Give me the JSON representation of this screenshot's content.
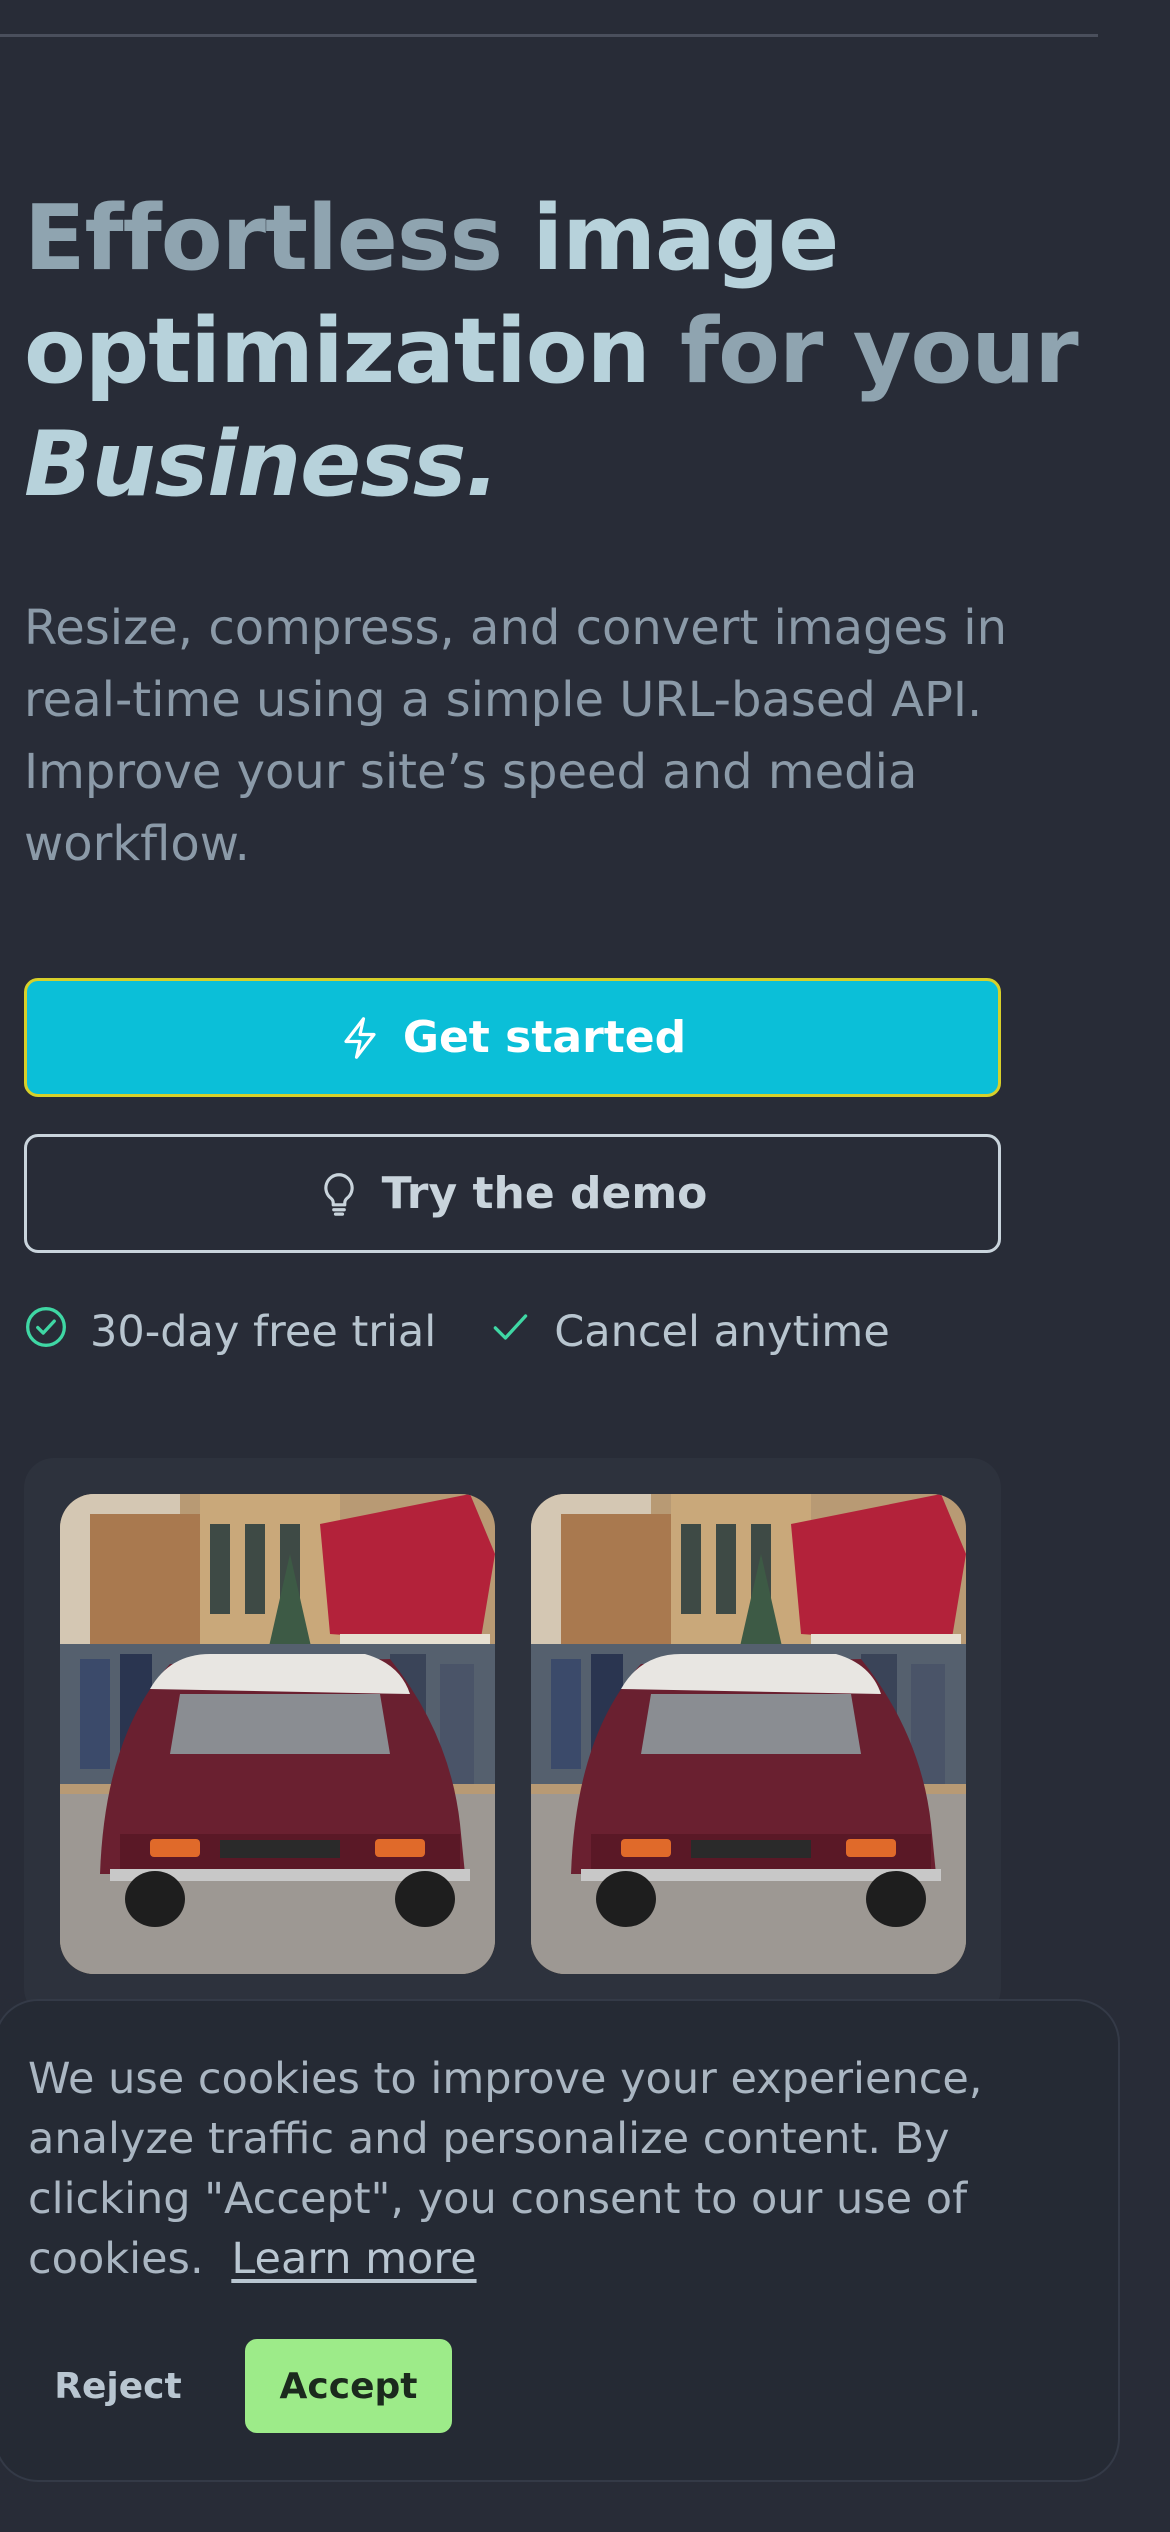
{
  "hero": {
    "title_word1": "Effortless",
    "title_word2": "image",
    "title_word3": "optimization",
    "title_word4": "for your",
    "title_word5": "Business."
  },
  "subtitle": "Resize, compress, and convert images in real-time using a simple URL-based API. Improve your site’s speed and media workflow.",
  "buttons": {
    "primary_label": "Get started",
    "primary_icon": "lightning-icon",
    "secondary_label": "Try the demo",
    "secondary_icon": "lightbulb-icon"
  },
  "badges": [
    {
      "label": "30-day free trial",
      "icon": "check-circle-icon"
    },
    {
      "label": "Cancel anytime",
      "icon": "check-icon"
    }
  ],
  "gallery": {
    "images": [
      "vintage-red-car-street-photo",
      "vintage-red-car-street-photo"
    ]
  },
  "cookie_banner": {
    "text": "We use cookies to improve your experience, analyze traffic and personalize content. By clicking \"Accept\", you consent to our use of cookies.",
    "learn_more": "Learn more",
    "reject_label": "Reject",
    "accept_label": "Accept"
  },
  "colors": {
    "background": "#282c37",
    "accent": "#0bbfd8",
    "accept": "#9deb89",
    "check": "#3fd7a4"
  }
}
